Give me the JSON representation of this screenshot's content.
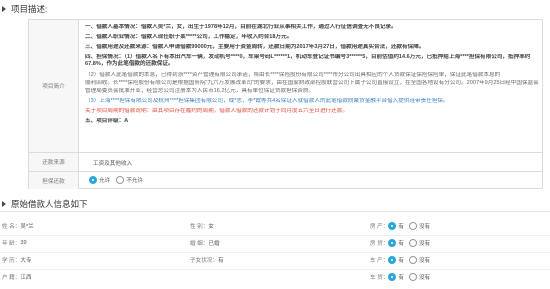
{
  "project_desc": {
    "title": "项目描述:",
    "main_label": "项目简介",
    "lines": [
      "一、借款人基本情况：借款人吴*兰，女，出生于1978年12月，目前在湖北行业从事相关工作，通过人行征信调查无不良记录。",
      "二、借款人职业情况：借款人现任职于某*****公司，工作稳定，年收入约合18万元。",
      "三、借款用途及还款来源：借款人申请借款99000元，主要用于资金周转，还款日期为2017年3月27日，借款用途真实合法，还款有保障。",
      "四、担保情况：（1）借款人名下有本田汽车一辆，发动机号****0，车架号码L******1，机动车登记证书编号3******5，目前估值约14.6万元，已抵押给上海****担保有限公司，抵押率约67.8%，作为此笔借款的还款保证。",
      "（2）借款人此笔借款的本息，已得到浙****资产管理有限公司承诺，将由长****保险股份有限公司****市分公司出具相应的个人贷款保证保险保险单，保证此笔借款本息的",
      "顺利回收。长****保险股份有限公司是根据国务院“九六万发展改革司”的要求，由在国家财政部控股联营公司下属子公司直接设立，在全国各地设有分公司。2007年9月25日经中国保监会",
      "管理局委员会批准开业，经营总公司注册本为人民币16.2亿元，具有单位保证贷款担保资质。",
      "（3）上海****担保有限公司及杭州****担保集团有限公司，成*志，李*霞等共4名保证人就借款人的此笔借款向聚贷金融平台借入提供连带责任担保。",
      "关于项目周期的借款说明：由其项目存在履约的周期，借款人借款的还款计划于同月度五六至日进行还款。",
      "五、项目评级：A"
    ],
    "source_label": "还款来源",
    "source_value": "工资及其他收入",
    "guarantee_label": "担保还款",
    "guarantee_options": [
      "允许",
      "不允许"
    ],
    "guarantee_selected": "允许"
  },
  "borrower": {
    "title": "原始借款人信息如下",
    "rows": [
      {
        "col1": {
          "key": "姓 名：",
          "value": "吴*兰"
        },
        "col2": {
          "key": "性 别：",
          "value": "女"
        },
        "col3": {
          "key": "房 产：",
          "options": [
            "有",
            "没有"
          ],
          "selected": "有"
        }
      },
      {
        "col1": {
          "key": "年 龄：",
          "value": "39"
        },
        "col2": {
          "key": "婚 姻：",
          "value": "已婚"
        },
        "col3": {
          "key": "房 贷：",
          "options": [
            "有",
            "没有"
          ],
          "selected": "有"
        }
      },
      {
        "col1": {
          "key": "学 历：",
          "value": "大专"
        },
        "col2": {
          "key": "子女状况：",
          "value": "有"
        },
        "col3": {
          "key": "车 产：",
          "options": [
            "有",
            "没有"
          ],
          "selected": "有"
        }
      },
      {
        "col1": {
          "key": "户 籍：",
          "value": "江西"
        },
        "col2": {
          "key": "",
          "value": ""
        },
        "col3": {
          "key": "车 贷：",
          "options": [
            "有",
            "没有"
          ],
          "selected": "有"
        }
      }
    ]
  },
  "colors": {
    "accent": "#2aa6d9",
    "highlight_red": "#e04b3a",
    "highlight_blue": "#3a7fc4"
  }
}
